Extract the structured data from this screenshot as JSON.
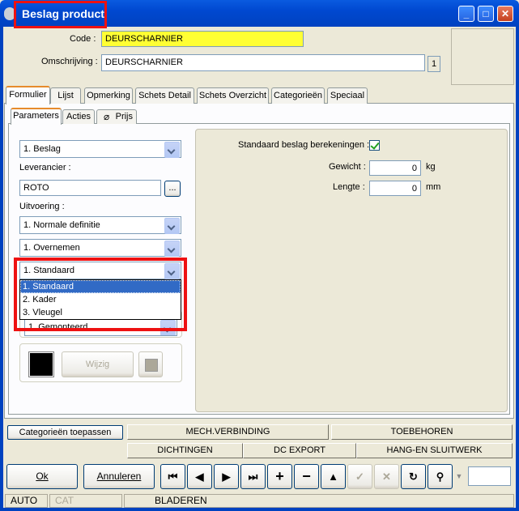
{
  "window": {
    "title": "Beslag product"
  },
  "header": {
    "code_label": "Code :",
    "code_value": "DEURSCHARNIER",
    "omschrijving_label": "Omschrijving :",
    "omschrijving_value": "DEURSCHARNIER",
    "language_index": "1"
  },
  "tabs": [
    "Formulier",
    "Lijst",
    "Opmerking",
    "Schets Detail",
    "Schets Overzicht",
    "Categorieën",
    "Speciaal"
  ],
  "subtabs": [
    "Parameters",
    "Acties",
    "Prijs"
  ],
  "left": {
    "type_combo": "1.  Beslag",
    "leverancier_label": "Leverancier :",
    "leverancier_value": "ROTO",
    "browse_button": "...",
    "uitvoering_label": "Uitvoering :",
    "uitvoering_combo": "1.  Normale definitie",
    "mode_combo": "1.  Overnemen",
    "kind_combo": "1.  Standaard",
    "dropdown_options": [
      "1.  Standaard",
      "2.  Kader",
      "3.  Vleugel"
    ],
    "hidden_combo": "1.  Gemonteerd",
    "wijzig_button": "Wijzig",
    "color_swatch": "#000000"
  },
  "right": {
    "standaard_label": "Standaard beslag berekeningen :",
    "gewicht_label": "Gewicht :",
    "gewicht_value": "0",
    "gewicht_unit": "kg",
    "lengte_label": "Lengte :",
    "lengte_value": "0",
    "lengte_unit": "mm"
  },
  "actions": {
    "categorieen": "Categorieën toepassen",
    "mech": "MECH.VERBINDING",
    "toebehoren": "TOEBEHOREN",
    "dichtingen": "DICHTINGEN",
    "dcexport": "DC EXPORT",
    "hang": "HANG-EN SLUITWERK"
  },
  "buttons": {
    "ok": "Ok",
    "annuleren": "Annuleren"
  },
  "status": {
    "mode": "AUTO",
    "cat": "CAT",
    "state": "BLADEREN"
  }
}
